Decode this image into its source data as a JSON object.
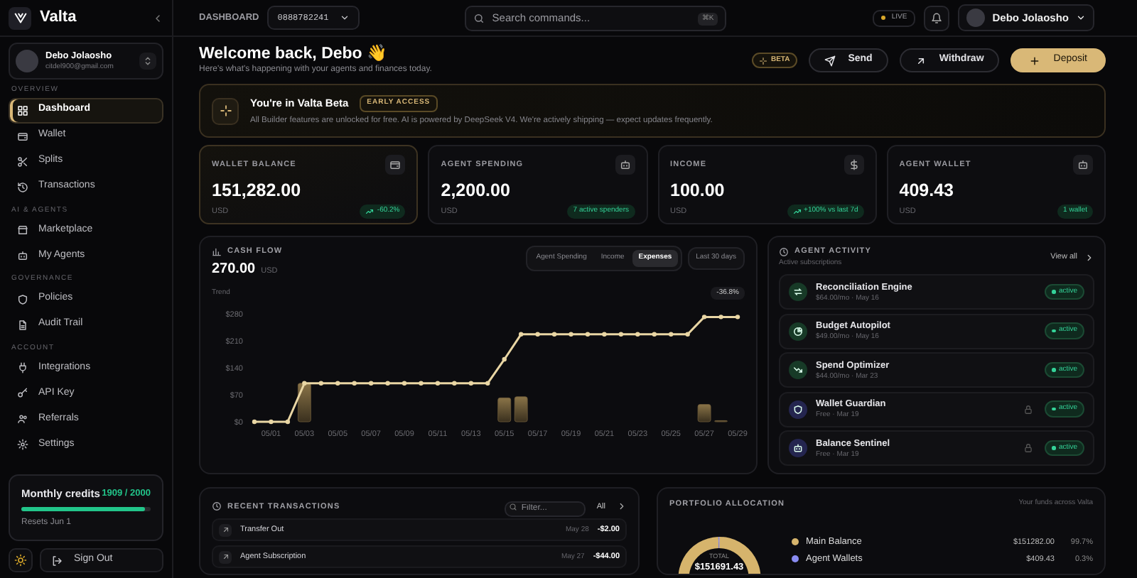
{
  "sidebar": {
    "brand": "Valta",
    "user": {
      "name": "Debo Jolaosho",
      "email": "citdel900@gmail.com"
    },
    "sections": [
      {
        "title": "OVERVIEW",
        "items": [
          {
            "label": "Dashboard",
            "selected": true
          },
          {
            "label": "Wallet",
            "selected": false
          },
          {
            "label": "Splits",
            "selected": false
          },
          {
            "label": "Transactions",
            "selected": false
          }
        ]
      },
      {
        "title": "AI & AGENTS",
        "items": [
          {
            "label": "Marketplace",
            "selected": false
          },
          {
            "label": "My Agents",
            "selected": false
          }
        ]
      },
      {
        "title": "GOVERNANCE",
        "items": [
          {
            "label": "Policies",
            "selected": false
          },
          {
            "label": "Audit Trail",
            "selected": false
          }
        ]
      },
      {
        "title": "ACCOUNT",
        "items": [
          {
            "label": "Integrations",
            "selected": false
          },
          {
            "label": "API Key",
            "selected": false
          },
          {
            "label": "Referrals",
            "selected": false
          },
          {
            "label": "Settings",
            "selected": false
          }
        ]
      }
    ],
    "credits": {
      "title": "Monthly credits",
      "count": "1909 / 2000",
      "level": 0.9545,
      "note": "Resets Jun 1"
    },
    "sign_out": "Sign Out"
  },
  "header": {
    "page": "DASHBOARD",
    "account": "0888782241",
    "search_placeholder": "Search commands...",
    "shortcut": "⌘K",
    "live": "LIVE",
    "user": "Debo Jolaosho"
  },
  "welcome": {
    "title": "Welcome back, Debo 👋",
    "subtitle": "Here's what's happening with your agents and finances today.",
    "beta": "BETA",
    "actions": [
      {
        "label": "Send",
        "kind": "send"
      },
      {
        "label": "Withdraw",
        "kind": "withdraw"
      },
      {
        "label": "Deposit",
        "kind": "deposit"
      }
    ]
  },
  "banner": {
    "title": "You're in Valta Beta",
    "tag": "EARLY ACCESS",
    "text": "All Builder features are unlocked for free. AI is powered by DeepSeek V4. We're actively shipping — expect updates frequently."
  },
  "stats": [
    {
      "label": "WALLET BALANCE",
      "value": "151,282.00",
      "unit": "USD",
      "badge": "-60.2%",
      "trend": true,
      "selected": true
    },
    {
      "label": "AGENT SPENDING",
      "value": "2,200.00",
      "unit": "USD",
      "badge": "7 active spenders",
      "trend": false,
      "selected": false
    },
    {
      "label": "INCOME",
      "value": "100.00",
      "unit": "USD",
      "badge": "+100% vs last 7d",
      "trend": true,
      "selected": false
    },
    {
      "label": "AGENT WALLET",
      "value": "409.43",
      "unit": "USD",
      "badge": "1 wallet",
      "trend": false,
      "selected": false
    }
  ],
  "cash_flow": {
    "title": "CASH FLOW",
    "total": "270.00",
    "unit": "USD",
    "tabs": [
      {
        "label": "Agent Spending",
        "selected": false
      },
      {
        "label": "Income",
        "selected": false
      },
      {
        "label": "Expenses",
        "selected": true
      }
    ],
    "range": "Last 30 days",
    "change": "-36.8%",
    "chart_data": {
      "type": "line",
      "categories": [
        null,
        "05/01",
        null,
        "05/03",
        null,
        "05/05",
        null,
        "05/07",
        null,
        "05/09",
        null,
        "05/11",
        null,
        "05/13",
        null,
        "05/15",
        null,
        "05/17",
        null,
        "05/19",
        null,
        "05/21",
        null,
        "05/23",
        null,
        "05/25",
        null,
        "05/27",
        null,
        "05/29"
      ],
      "ylim": [
        0,
        280
      ],
      "yticks": [
        {
          "value": 0,
          "label": "$0"
        },
        {
          "value": 70,
          "label": "$70"
        },
        {
          "value": 140,
          "label": "$140"
        },
        {
          "value": 210,
          "label": "$210"
        },
        {
          "value": 280,
          "label": "$280"
        }
      ],
      "series": [
        {
          "name": "Trend",
          "type": "line",
          "marker": true,
          "color": "#e9d6a4",
          "values": [
            0,
            0,
            0,
            100,
            100,
            100,
            100,
            100,
            100,
            100,
            100,
            100,
            100,
            100,
            100,
            162,
            227,
            227,
            227,
            227,
            227,
            227,
            227,
            227,
            227,
            227,
            227,
            272,
            272,
            272
          ]
        },
        {
          "type": "bar",
          "color": "#6e5c3a",
          "values": [
            null,
            null,
            null,
            100,
            null,
            null,
            null,
            null,
            null,
            null,
            null,
            null,
            null,
            null,
            null,
            62,
            65,
            null,
            null,
            null,
            null,
            null,
            null,
            null,
            null,
            null,
            null,
            45,
            3,
            null
          ]
        }
      ]
    }
  },
  "agent_activity": {
    "title": "AGENT ACTIVITY",
    "subtitle": "Active subscriptions",
    "view_all": "View all",
    "agents": [
      {
        "name": "Reconciliation Engine",
        "meta": "$64.00/mo · May 16",
        "status": "active",
        "locked": false,
        "color": "#173a27"
      },
      {
        "name": "Budget Autopilot",
        "meta": "$49.00/mo · May 16",
        "status": "active",
        "locked": false,
        "color": "#173a27"
      },
      {
        "name": "Spend Optimizer",
        "meta": "$44.00/mo · Mar 23",
        "status": "active",
        "locked": false,
        "color": "#173a27"
      },
      {
        "name": "Wallet Guardian",
        "meta": "Free · Mar 19",
        "status": "active",
        "locked": true,
        "color": "#24254f"
      },
      {
        "name": "Balance Sentinel",
        "meta": "Free · Mar 19",
        "status": "active",
        "locked": true,
        "color": "#24254f"
      }
    ]
  },
  "transactions": {
    "title": "RECENT TRANSACTIONS",
    "filter_placeholder": "Filter...",
    "scope": "All",
    "rows": [
      {
        "label": "Transfer Out",
        "date": "May 28",
        "amount": "-$2.00"
      },
      {
        "label": "Agent Subscription",
        "date": "May 27",
        "amount": "-$44.00"
      }
    ]
  },
  "portfolio": {
    "title": "PORTFOLIO ALLOCATION",
    "subtitle": "Your funds across Valta",
    "total_label": "TOTAL",
    "total": "$151691.43",
    "legend": [
      {
        "amount": "$151282.00",
        "share": "99.7%",
        "color": "#d6b46c"
      },
      {
        "amount": "$409.43",
        "share": "0.3%",
        "color": "#8a8cf2"
      }
    ],
    "chart_data": {
      "type": "donut",
      "categories": [
        "Main Balance",
        "Agent Wallets"
      ],
      "values": [
        99.7,
        0.3
      ]
    }
  }
}
